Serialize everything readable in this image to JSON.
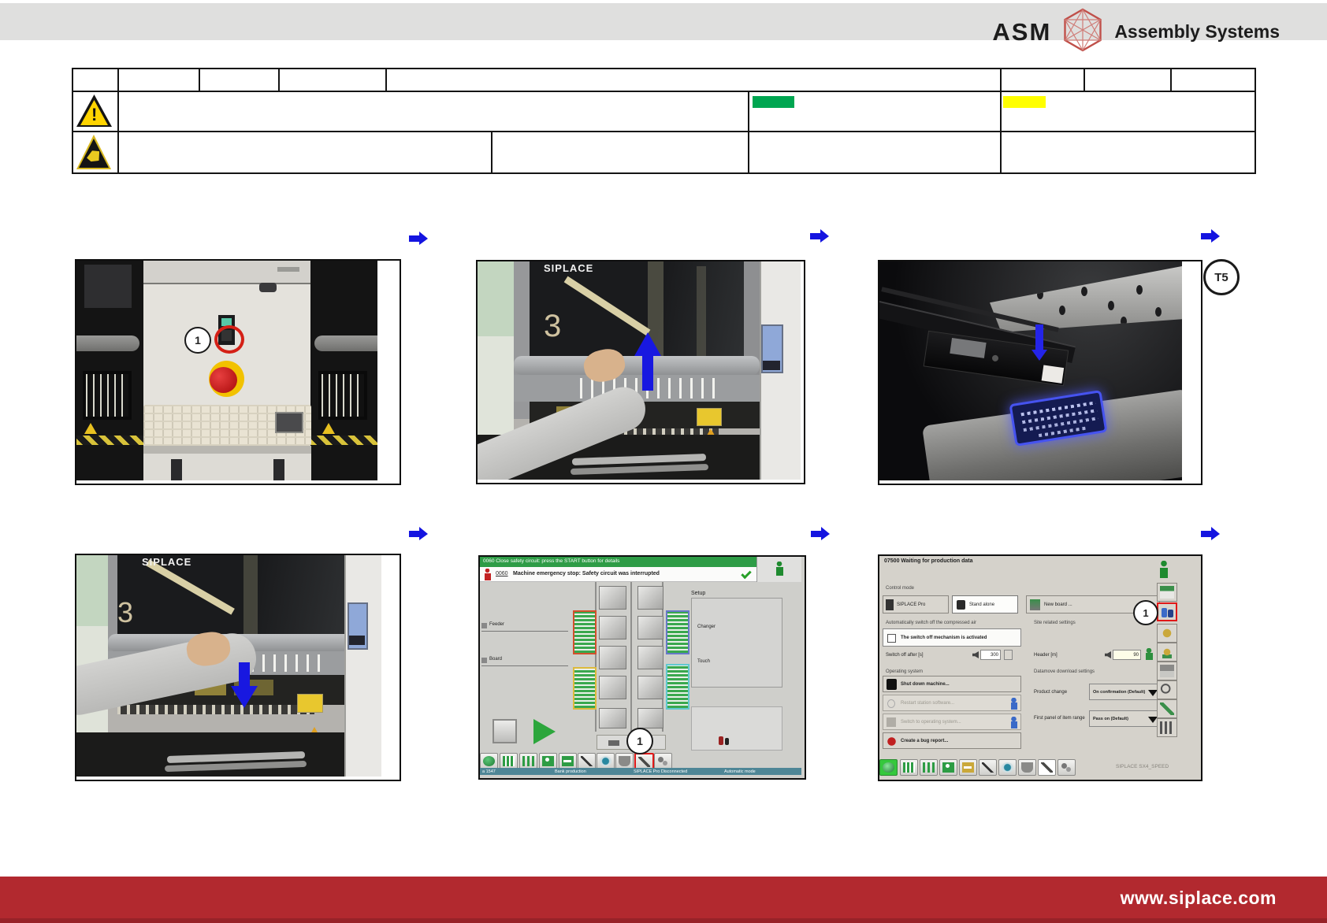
{
  "header": {
    "brand": "ASM",
    "brand_suffix": "Assembly Systems"
  },
  "legend": {
    "warning_mark": "!",
    "green_swatch_color": "#00a651",
    "yellow_swatch_color": "#ffff00"
  },
  "badges": {
    "t5": "T5",
    "step": "1"
  },
  "machine_photos": {
    "brand": "SIPLACE",
    "gantry_digit": "3"
  },
  "station_screen": {
    "titlebar": "0060 Close safety circuit: press the START button for details",
    "message_code": "0060",
    "message_text": "Machine emergency stop: Safety circuit was interrupted",
    "feeder_label": "Feeder",
    "board_label": "Board",
    "setup_label": "Setup",
    "changer_label": "Changer",
    "touch_label": "Touch",
    "status_left": "a 1547",
    "status_production": "Bank production",
    "status_connection": "SIPLACE Pro Disconnected",
    "status_mode": "Automatic mode"
  },
  "settings_screen": {
    "title": "07500 Waiting for production data",
    "control_mode": "Control mode",
    "siplace_pro": "SIPLACE Pro",
    "stand_alone": "Stand alone",
    "new_board": "New board ...",
    "air_section": "Automatically switch off the compressed air",
    "checkbox_text": "The switch off mechanism is activated",
    "switch_off": "Switch off after [s]",
    "switch_off_value": "300",
    "site_settings": "Site related settings",
    "header_m": "Header [m]",
    "header_value": "90",
    "os_section": "Operating system",
    "shutdown": "Shut down machine...",
    "restart": "Restart station software...",
    "switch_os": "Switch to operating system...",
    "bug_report": "Create a bug report...",
    "download_section": "Datamove download settings",
    "product_change": "Product change",
    "product_change_value": "On confirmation (Default)",
    "first_panel": "First panel of item range",
    "first_panel_value": "Pass on (Default)",
    "model": "SIPLACE SX4_SPEED"
  },
  "footer": {
    "url": "www.siplace.com"
  },
  "colors": {
    "arrow_blue": "#1414e0",
    "footer_red": "#b2292f",
    "screen_green_bar": "#2e9c46",
    "status_teal": "#4e8696"
  }
}
